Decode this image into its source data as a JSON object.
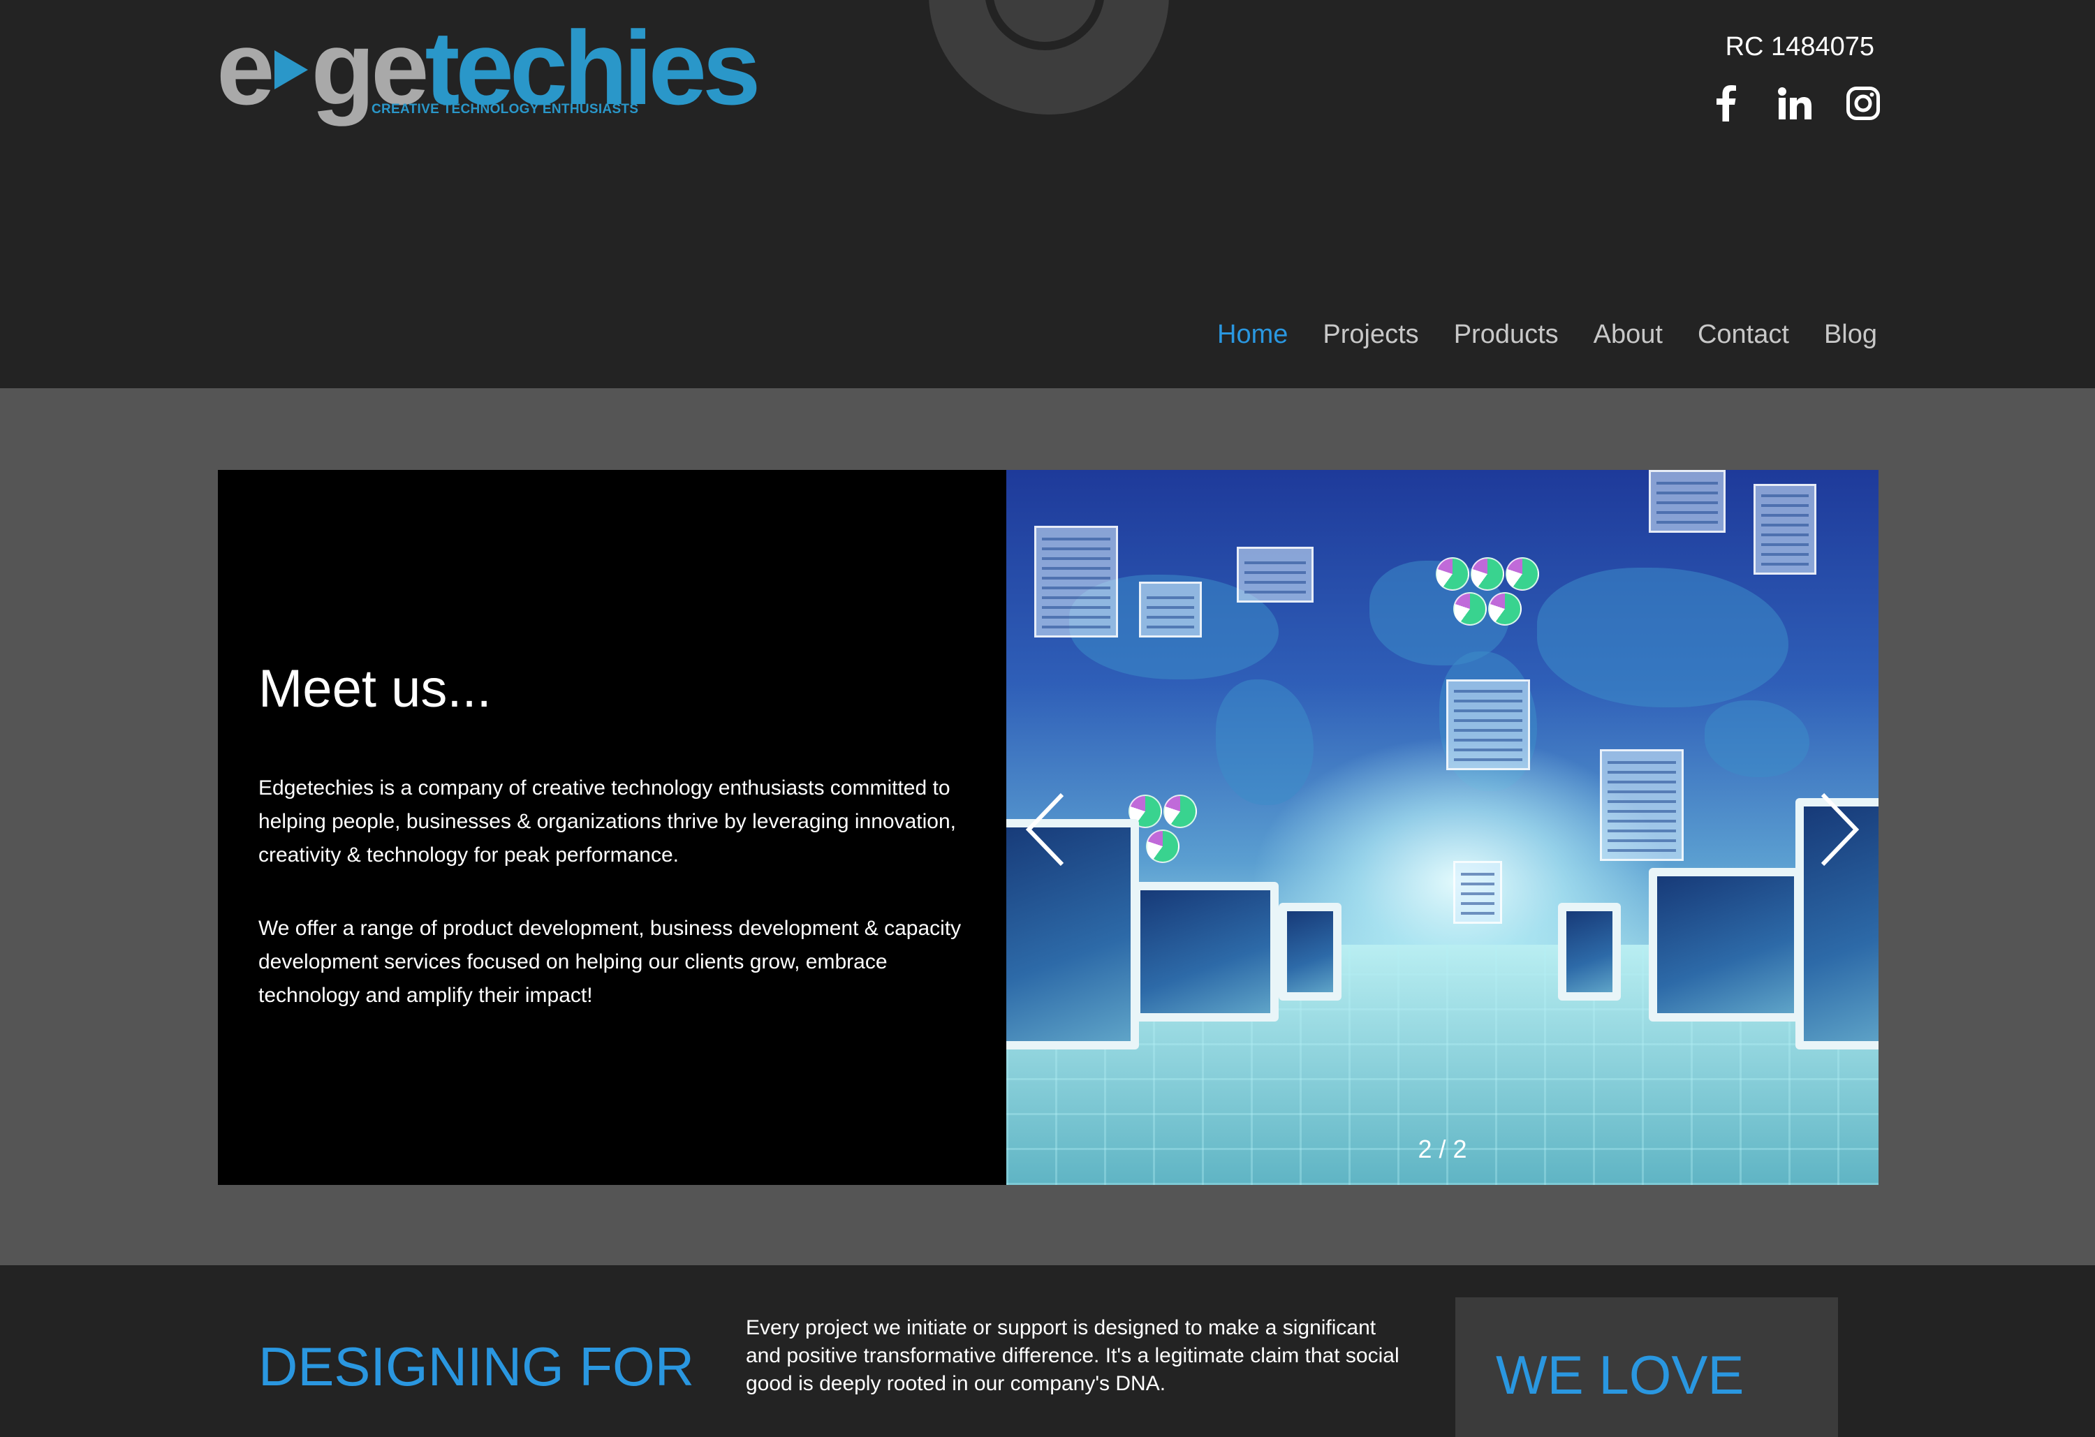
{
  "header": {
    "logo": {
      "part1": "e",
      "part2": "ge",
      "part3": "techies",
      "tagline": "CREATIVE TECHNOLOGY ENTHUSIASTS"
    },
    "rc_number": "RC 1484075",
    "social": [
      "facebook-icon",
      "linkedin-icon",
      "instagram-icon"
    ],
    "nav": {
      "items": [
        "Home",
        "Projects",
        "Products",
        "About",
        "Contact",
        "Blog"
      ],
      "active": "Home"
    }
  },
  "hero": {
    "title": "Meet us...",
    "paragraph1": "Edgetechies is a company of creative technology enthusiasts committed to helping people, businesses & organizations thrive by leveraging innovation, creativity & technology for peak performance.",
    "paragraph2": "We offer a range of product development, business development & capacity development services focused on helping our clients grow, embrace technology and amplify their impact!",
    "slider": {
      "counter": "2 / 2",
      "prev_icon": "chevron-left-icon",
      "next_icon": "chevron-right-icon"
    }
  },
  "bottom": {
    "designing_title": "DESIGNING FOR",
    "designing_text": "Every project we initiate or support is designed to make a significant and positive transformative difference. It's a legitimate claim that social good is deeply rooted in our company's DNA.",
    "welove_title": "WE LOVE"
  },
  "colors": {
    "header_bg": "#232323",
    "hero_bg": "#555555",
    "accent": "#2a97e0",
    "logo_gray": "#a9a9a9",
    "logo_blue": "#2a97c9"
  }
}
